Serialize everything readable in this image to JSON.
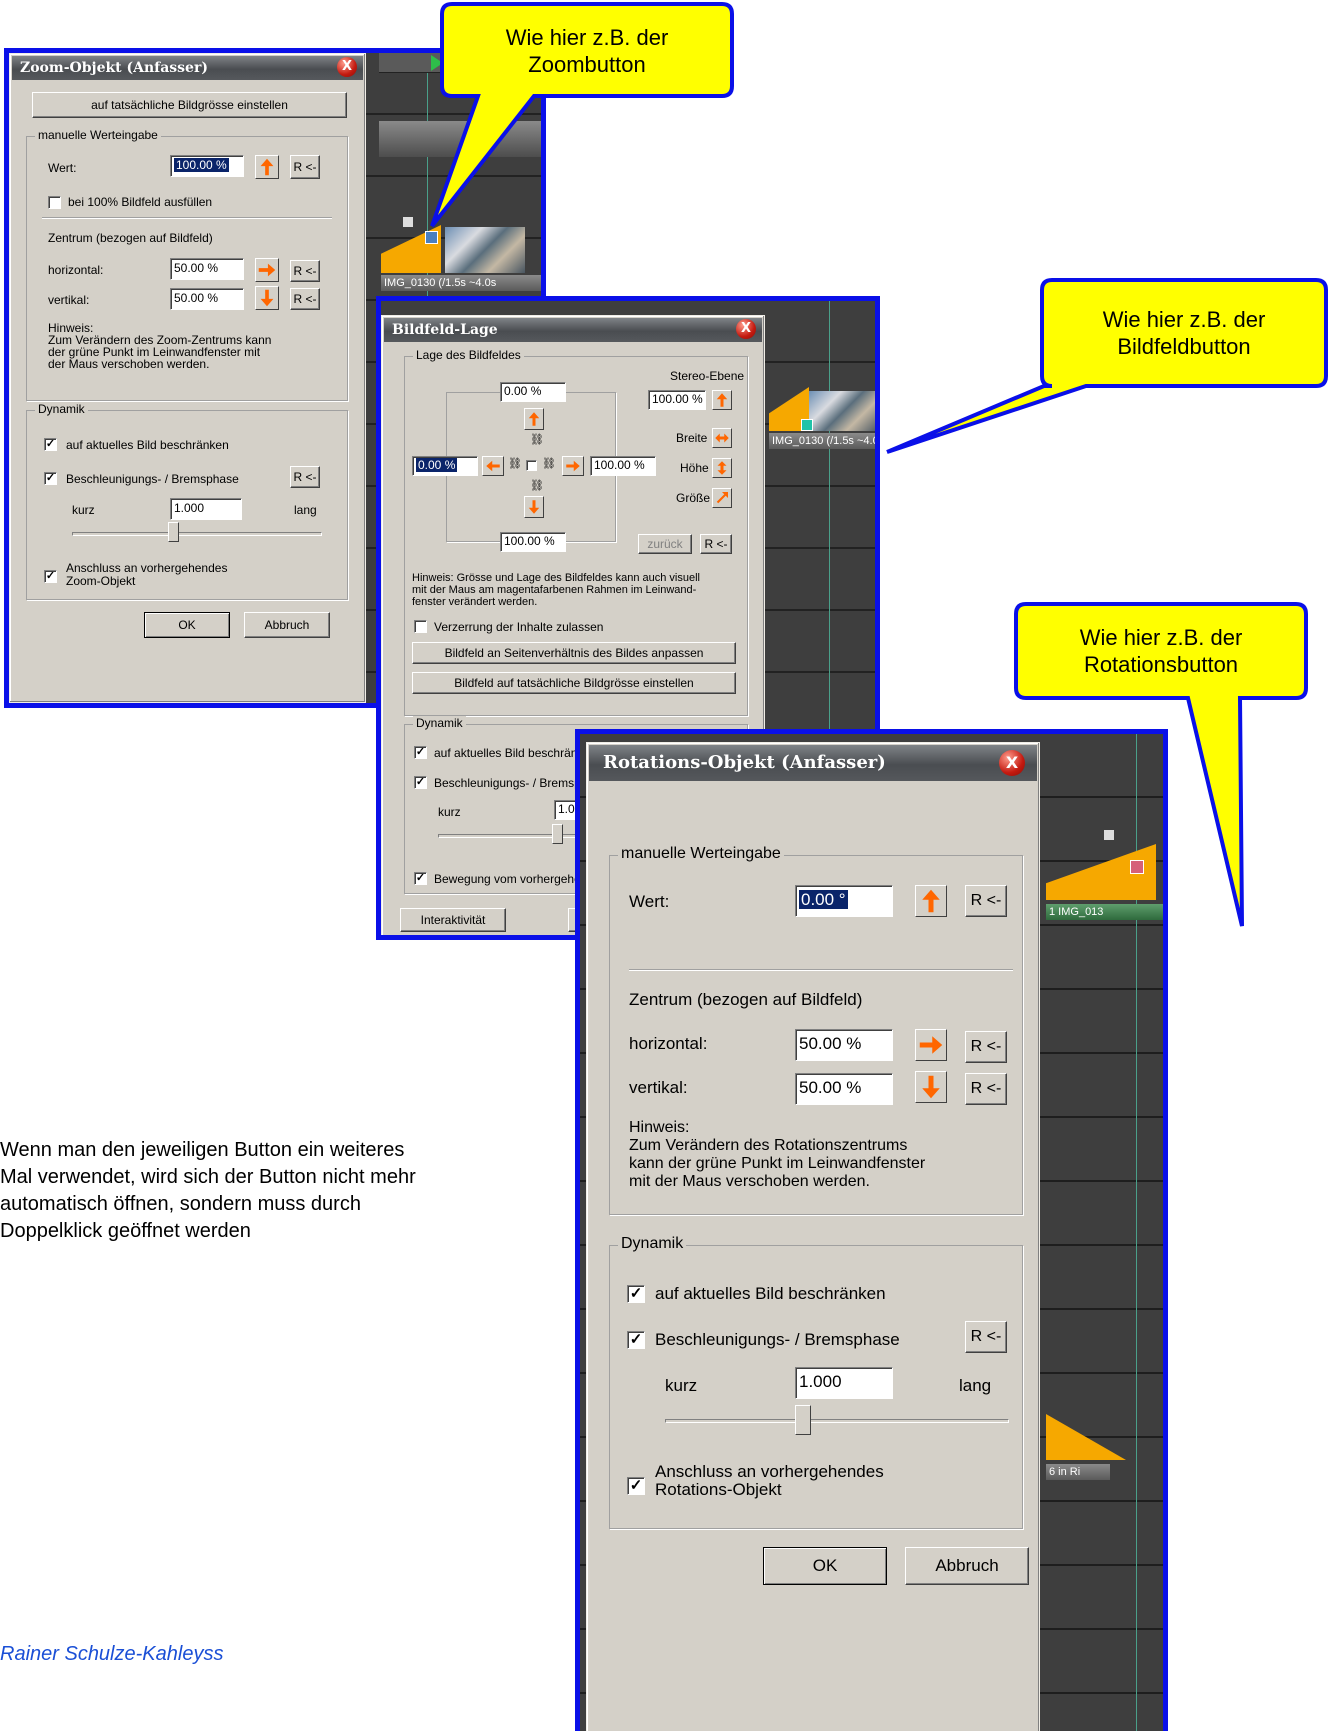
{
  "callouts": {
    "zoom": "Wie hier z.B. der Zoombutton",
    "zoom_line1": "Wie hier z.B. der",
    "zoom_line2": "Zoombutton",
    "bildfeld_line1": "Wie hier z.B. der",
    "bildfeld_line2": "Bildfeldbutton",
    "rotation_line1": "Wie hier z.B. der",
    "rotation_line2": "Rotationsbutton"
  },
  "zoom_dialog": {
    "title": "Zoom-Objekt (Anfasser)",
    "close": "X",
    "set_actual_size": "auf tatsächliche Bildgrösse einstellen",
    "manual_group": "manuelle Werteingabe",
    "wert_label": "Wert:",
    "wert_value": "100.00 %",
    "r_button": "R <-",
    "fill_checkbox": "bei 100% Bildfeld ausfüllen",
    "center_heading": "Zentrum (bezogen auf Bildfeld)",
    "horizontal_label": "horizontal:",
    "horizontal_value": "50.00 %",
    "vertikal_label": "vertikal:",
    "vertikal_value": "50.00 %",
    "hint_line1": "Hinweis:",
    "hint_line2": "Zum Verändern des Zoom-Zentrums kann",
    "hint_line3": "der grüne Punkt im Leinwandfenster mit",
    "hint_line4": "der Maus verschoben werden.",
    "dyn_group": "Dynamik",
    "limit_checkbox": "auf aktuelles Bild beschränken",
    "accel_checkbox": "Beschleunigungs- / Bremsphase",
    "kurz": "kurz",
    "accel_value": "1.000",
    "lang": "lang",
    "connect_line1": "Anschluss an vorhergehendes",
    "connect_line2": "Zoom-Objekt",
    "ok": "OK",
    "cancel": "Abbruch",
    "clip_label": "IMG_0130 (/1.5s ~4.0s"
  },
  "bildfeld_dialog": {
    "title": "Bildfeld-Lage",
    "close": "X",
    "group": "Lage des Bildfeldes",
    "top_value": "0.00 %",
    "left_value": "0.00 %",
    "right_value": "100.00 %",
    "bottom_value": "100.00 %",
    "stereo_label": "Stereo-Ebene",
    "stereo_value": "100.00 %",
    "breite": "Breite",
    "hoehe": "Höhe",
    "groesse": "Größe",
    "zurueck": "zurück",
    "r_button": "R <-",
    "hint_line1": "Hinweis: Grösse und Lage des Bildfeldes kann auch visuell",
    "hint_line2": "mit der Maus am magentafarbenen Rahmen im Leinwand-",
    "hint_line3": "fenster verändert werden.",
    "distort_checkbox": "Verzerrung der Inhalte zulassen",
    "aspect_button": "Bildfeld an Seitenverhältnis des Bildes anpassen",
    "actual_button": "Bildfeld auf tatsächliche Bildgrösse einstellen",
    "dyn_group": "Dynamik",
    "limit_checkbox": "auf aktuelles Bild beschränk",
    "accel_checkbox": "Beschleunigungs- / Bremsp",
    "kurz": "kurz",
    "accel_value": "1.00",
    "move_checkbox": "Bewegung vom vorhergehe",
    "interactivity": "Interaktivität",
    "clip_label": "IMG_0130 (/1.5s ~4.0"
  },
  "rotation_dialog": {
    "title": "Rotations-Objekt (Anfasser)",
    "close": "X",
    "manual_group": "manuelle Werteingabe",
    "wert_label": "Wert:",
    "wert_value": "0.00 °",
    "r_button": "R <-",
    "center_heading": "Zentrum (bezogen auf Bildfeld)",
    "horizontal_label": "horizontal:",
    "horizontal_value": "50.00 %",
    "vertikal_label": "vertikal:",
    "vertikal_value": "50.00 %",
    "hint_line1": "Hinweis:",
    "hint_line2": "Zum Verändern des Rotationszentrums",
    "hint_line3": "kann der grüne Punkt im Leinwandfenster",
    "hint_line4": "mit der Maus verschoben werden.",
    "dyn_group": "Dynamik",
    "limit_checkbox": "auf aktuelles Bild beschränken",
    "accel_checkbox": "Beschleunigungs- / Bremsphase",
    "kurz": "kurz",
    "accel_value": "1.000",
    "lang": "lang",
    "connect_line1": "Anschluss an vorhergehendes",
    "connect_line2": "Rotations-Objekt",
    "ok": "OK",
    "cancel": "Abbruch",
    "clip_label": "1   IMG_013",
    "clip_label2": "6 in Ri"
  },
  "body": {
    "line1": "Wenn man den jeweiligen Button ein weiteres",
    "line2": "Mal verwendet, wird sich der Button nicht mehr",
    "line3": "automatisch öffnen, sondern muss durch",
    "line4": "Doppelklick geöffnet werden",
    "author": "Rainer Schulze-Kahleyss"
  },
  "colors": {
    "frame_border": "#0a10e8",
    "callout_fill": "#ffff00",
    "callout_border": "#0a10e8",
    "arrow_orange": "#ff6600",
    "clip_orange": "#f6a800"
  }
}
